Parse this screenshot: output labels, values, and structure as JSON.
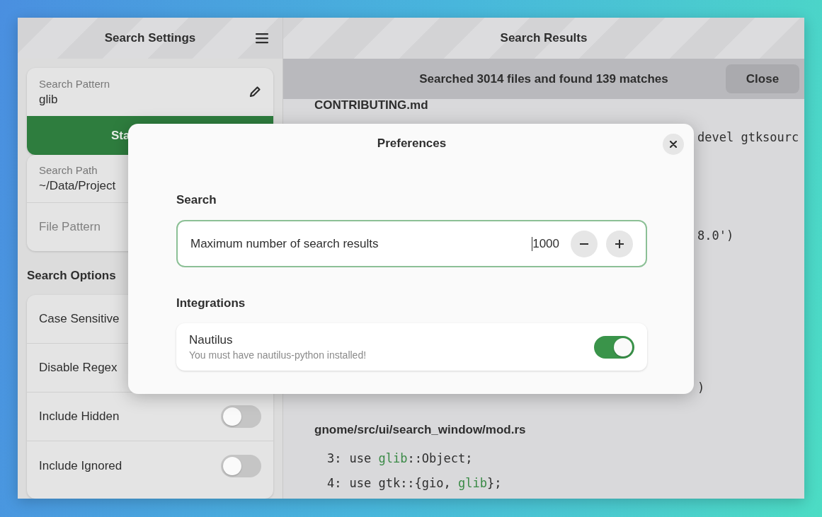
{
  "sidebar": {
    "title": "Search Settings",
    "pattern_field": {
      "label": "Search Pattern",
      "value": "glib"
    },
    "start_button": {
      "label": "Sta"
    },
    "path_field": {
      "label": "Search Path",
      "value": "~/Data/Project"
    },
    "file_pattern_field": {
      "placeholder": "File Pattern"
    },
    "options_heading": "Search Options",
    "options": [
      {
        "label": "Case Sensitive",
        "kind": "plain"
      },
      {
        "label": "Disable Regex",
        "kind": "plain"
      },
      {
        "label": "Include Hidden",
        "kind": "switch",
        "on": false
      },
      {
        "label": "Include Ignored",
        "kind": "switch",
        "on": false
      }
    ]
  },
  "results": {
    "title": "Search Results",
    "banner": {
      "text": "Searched 3014 files and found 139 matches",
      "button": "Close"
    },
    "files": [
      {
        "name": "CONTRIBUTING.md",
        "lines": [
          {
            "kind": "fragment",
            "segments": [
              {
                "text": "devel gtksourc",
                "match": false
              }
            ]
          },
          {
            "kind": "fragment",
            "segments": [
              {
                "text": "8.0')",
                "match": false
              }
            ]
          },
          {
            "kind": "fragment",
            "segments": [
              {
                "text": ")",
                "match": false
              }
            ]
          }
        ]
      },
      {
        "name": "gnome/src/ui/search_window/mod.rs",
        "lines": [
          {
            "kind": "numbered",
            "number": "3:",
            "segments": [
              {
                "text": "use ",
                "match": false
              },
              {
                "text": "glib",
                "match": true
              },
              {
                "text": "::Object;",
                "match": false
              }
            ]
          },
          {
            "kind": "numbered",
            "number": "4:",
            "segments": [
              {
                "text": "use gtk::{gio, ",
                "match": false
              },
              {
                "text": "glib",
                "match": true
              },
              {
                "text": "};",
                "match": false
              }
            ]
          }
        ]
      }
    ]
  },
  "dialog": {
    "title": "Preferences",
    "sections": [
      {
        "heading": "Search",
        "rows": [
          {
            "kind": "spin",
            "label": "Maximum number of search results",
            "value": "1000"
          }
        ]
      },
      {
        "heading": "Integrations",
        "rows": [
          {
            "kind": "switch",
            "title": "Nautilus",
            "subtitle": "You must have nautilus-python installed!",
            "on": true
          }
        ]
      }
    ]
  }
}
